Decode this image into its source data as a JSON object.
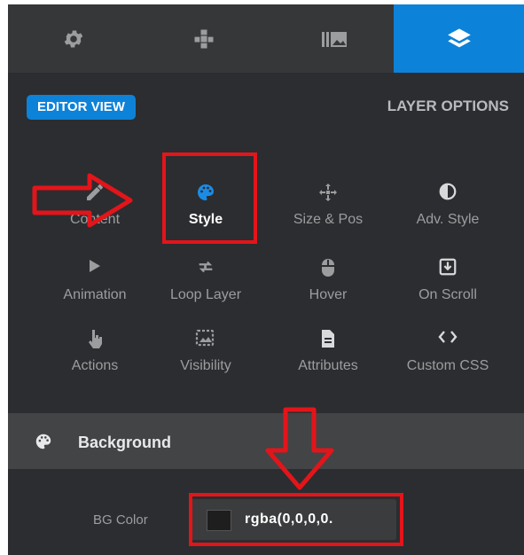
{
  "colors": {
    "panel_bg": "#2c2d30",
    "tab_bar_bg": "#363739",
    "accent": "#0d82d9",
    "annotation_red": "#e3151a"
  },
  "tabs": [
    {
      "icon": "gear-icon",
      "active": false
    },
    {
      "icon": "puzzle-icon",
      "active": false
    },
    {
      "icon": "image-library-icon",
      "active": false
    },
    {
      "icon": "layers-icon",
      "active": true
    }
  ],
  "header": {
    "editor_view": "EDITOR VIEW",
    "layer_options": "LAYER OPTIONS"
  },
  "options": [
    {
      "id": "content",
      "label": "Content",
      "icon": "pencil-icon"
    },
    {
      "id": "style",
      "label": "Style",
      "icon": "palette-icon",
      "active": true
    },
    {
      "id": "size-pos",
      "label": "Size & Pos",
      "icon": "move-icon"
    },
    {
      "id": "adv-style",
      "label": "Adv. Style",
      "icon": "contrast-icon"
    },
    {
      "id": "animation",
      "label": "Animation",
      "icon": "play-icon"
    },
    {
      "id": "loop-layer",
      "label": "Loop Layer",
      "icon": "loop-icon"
    },
    {
      "id": "hover",
      "label": "Hover",
      "icon": "mouse-icon"
    },
    {
      "id": "on-scroll",
      "label": "On Scroll",
      "icon": "scroll-download-icon"
    },
    {
      "id": "actions",
      "label": "Actions",
      "icon": "hand-pointer-icon"
    },
    {
      "id": "visibility",
      "label": "Visibility",
      "icon": "visibility-icon"
    },
    {
      "id": "attributes",
      "label": "Attributes",
      "icon": "file-icon"
    },
    {
      "id": "custom-css",
      "label": "Custom CSS",
      "icon": "code-icon"
    }
  ],
  "background": {
    "section_title": "Background",
    "bg_color_label": "BG Color",
    "bg_color_value": "rgba(0,0,0,0."
  }
}
